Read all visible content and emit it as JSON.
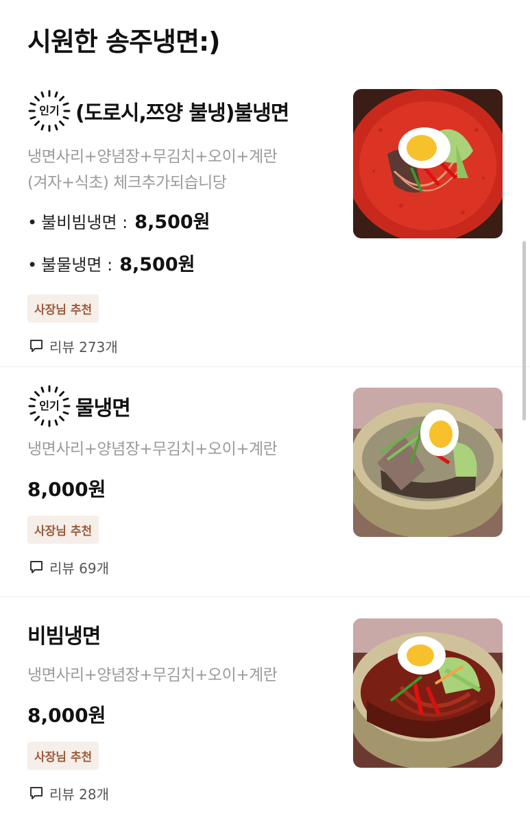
{
  "section": {
    "title": "시원한 송주냉면:)"
  },
  "popular_badge": "인기",
  "review_prefix": "리뷰",
  "items": [
    {
      "name": "(도로시,쯔양 불냉)불냉면",
      "description_lines": [
        "냉면사리+양념장+무김치+오이+계란",
        "(겨자+식초) 체크추가되습니당"
      ],
      "options": [
        {
          "bullet": "•",
          "label": "불비빔냉면 :",
          "price": "8,500원"
        },
        {
          "bullet": "•",
          "label": "불물냉면 :",
          "price": "8,500원"
        }
      ],
      "tag": "사장님 추천",
      "reviews": "리뷰 273개",
      "image_icon": "spicy-cold-noodle-photo"
    },
    {
      "name": "물냉면",
      "description_lines": [
        "냉면사리+양념장+무김치+오이+계란"
      ],
      "price": "8,000원",
      "tag": "사장님 추천",
      "reviews": "리뷰 69개",
      "image_icon": "mul-naengmyeon-photo"
    },
    {
      "name": "비빔냉면",
      "description_lines": [
        "냉면사리+양념장+무김치+오이+계란"
      ],
      "price": "8,000원",
      "tag": "사장님 추천",
      "reviews": "리뷰 28개",
      "image_icon": "bibim-naengmyeon-photo"
    }
  ],
  "colors": {
    "tag_bg": "#f5eee9",
    "tag_text": "#9c5a3a",
    "desc": "#9a9a9a"
  }
}
